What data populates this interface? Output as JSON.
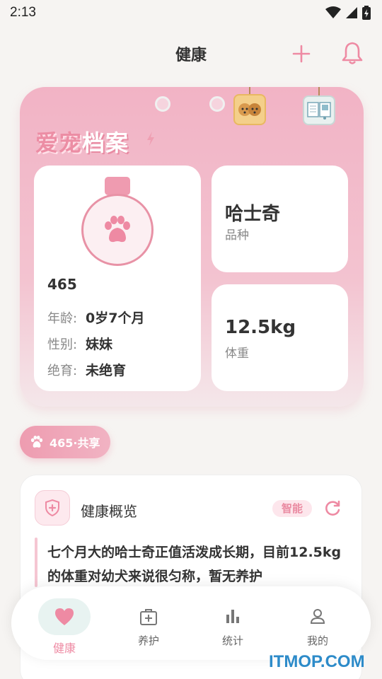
{
  "status_bar": {
    "time": "2:13"
  },
  "header": {
    "title": "健康"
  },
  "profile": {
    "brand_part1": "爱宠",
    "brand_part2": "档案",
    "pet_name": "465",
    "age_label": "年龄:",
    "age_value": "0岁7个月",
    "gender_label": "性别:",
    "gender_value": "妹妹",
    "neuter_label": "绝育:",
    "neuter_value": "未绝育",
    "breed_value": "哈士奇",
    "breed_label": "品种",
    "weight_value": "12.5kg",
    "weight_label": "体重"
  },
  "share_chip": {
    "label": "465·共享"
  },
  "overview": {
    "title": "健康概览",
    "badge": "智能",
    "text": "七个月大的哈士奇正值活泼成长期，目前12.5kg的体重对幼犬来说很匀称，暂无养护"
  },
  "nav": {
    "items": [
      {
        "label": "健康"
      },
      {
        "label": "养护"
      },
      {
        "label": "统计"
      },
      {
        "label": "我的"
      }
    ]
  },
  "watermark": {
    "text": "ITMOP.COM"
  },
  "colors": {
    "accent": "#ee8aa3",
    "card_pink": "#f2b3c5",
    "background": "#f6f4f2"
  }
}
